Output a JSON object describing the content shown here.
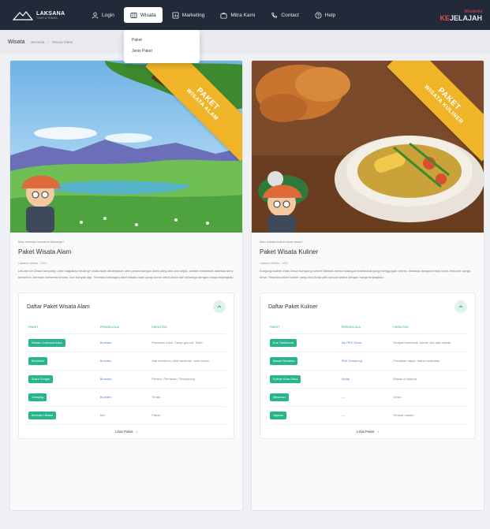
{
  "brand": {
    "name": "LAKSANA",
    "sub": "TOUR & TRAVEL"
  },
  "nav": {
    "items": [
      {
        "label": "Login",
        "icon": "user-icon"
      },
      {
        "label": "Wisata",
        "icon": "map-icon",
        "active": true
      },
      {
        "label": "Marketing",
        "icon": "chart-icon"
      },
      {
        "label": "Mitra Kami",
        "icon": "briefcase-icon"
      },
      {
        "label": "Contact",
        "icon": "phone-icon"
      },
      {
        "label": "Help",
        "icon": "help-icon"
      }
    ]
  },
  "right_logo": {
    "top": "Wonderful",
    "main_a": "KE",
    "main_b": "JELAJAH"
  },
  "dropdown": {
    "items": [
      "Paket",
      "Jenis Paket"
    ]
  },
  "breadcrumb": {
    "title": "Wisata",
    "trail": [
      "Beranda",
      "/",
      "Wisata Paket"
    ]
  },
  "cards": [
    {
      "ribbon_line1": "PAKET",
      "ribbon_line2": "WISATA ALAM",
      "kicker": "Mau rekreasi bersama keluarga?",
      "title": "Paket Wisata Alam",
      "meta": "Laksana Wisata - 2024",
      "description": "Liburan ke Desa Kampung Leteri bagaikan healing!! Anda akan dimanjakan oleh pemandangan alam yang asri dan sejuk, sambil menikmati aktivitas seru: berkebun, bermain bersama hewan, dan banyak lagi. Tersedia berbagai paket wisata alam yang cocok untuk Anda dan keluarga dengan harga terjangkau.",
      "package_title": "Daftar Paket Wisata Alam",
      "columns": [
        "PAKET",
        "PENGELOLA",
        "FASILITAS"
      ],
      "rows": [
        {
          "paket": "Wisata Outbound Alam",
          "pengelola": "Bumdes",
          "fasilitas": "Pemandu lokal, Camp ground, Toilet"
        },
        {
          "paket": "Berkebun",
          "pengelola": "Bumdes",
          "fasilitas": "Alat berkebun, bibit tanaman, area kebun"
        },
        {
          "paket": "Susur Sungai",
          "pengelola": "Bumdes",
          "fasilitas": "Perahu, Pemandu, Pelampung"
        },
        {
          "paket": "Camping",
          "pengelola": "Bumdes",
          "fasilitas": "Tenda"
        },
        {
          "paket": "Bermain Hewan",
          "pengelola": "Kel",
          "fasilitas": "Pakan"
        }
      ],
      "more_label": "Lihat Paket"
    },
    {
      "ribbon_line1": "PAKET",
      "ribbon_line2": "WISATA KULINER",
      "kicker": "Mau wisata kuliner khas desa?",
      "title": "Paket Wisata Kuliner",
      "meta": "Laksana Wisata - 2024",
      "description": "Kunjungi kuliner khas Desa Kampung Leteri! Nikmati aneka hidangan tradisional yang menggugah selera, dimasak dengan resep turun-temurun warga desa. Tersedia paket kuliner yang bisa Anda pilih sesuai selera dengan harga terjangkau.",
      "package_title": "Daftar Paket Kuliner",
      "columns": [
        "PAKET",
        "PENGELOLA",
        "FASILITAS"
      ],
      "rows": [
        {
          "paket": "Kue Tradisional",
          "pengelola": "Ibu PKK Desa",
          "fasilitas": "Tempat memasak, bahan dan alat masak"
        },
        {
          "paket": "Masak Bersama",
          "pengelola": "PKK Kampung",
          "fasilitas": "Peralatan dapur, bahan makanan"
        },
        {
          "paket": "Kuliner Khas Desa",
          "pengelola": "Kedai",
          "fasilitas": "Makan di tempat"
        },
        {
          "paket": "Minuman",
          "pengelola": "—",
          "fasilitas": "Gelas"
        },
        {
          "paket": "Jajanan",
          "pengelola": "—",
          "fasilitas": "Tempat makan"
        }
      ],
      "more_label": "Lihat Paket"
    }
  ]
}
